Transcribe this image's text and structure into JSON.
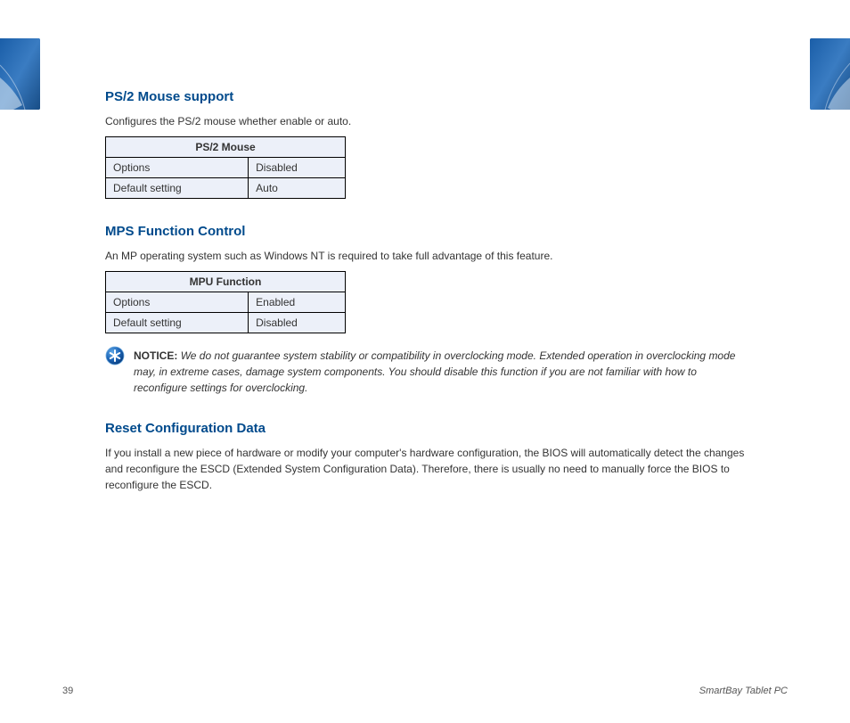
{
  "section1": {
    "title": "PS/2 Mouse support",
    "desc": "Configures the PS/2 mouse whether enable or auto.",
    "table": {
      "header": "PS/2 Mouse",
      "row1": {
        "label": "Options",
        "value": "Disabled"
      },
      "row2": {
        "label": "Default setting",
        "value": "Auto"
      }
    }
  },
  "section2": {
    "title": "MPS Function Control",
    "desc": "An MP operating system such as Windows NT is required to take full advantage of this feature.",
    "table": {
      "header": "MPU Function",
      "row1": {
        "label": "Options",
        "value": "Enabled"
      },
      "row2": {
        "label": "Default setting",
        "value": "Disabled"
      }
    }
  },
  "notice": {
    "label": "NOTICE:",
    "text": "We do not guarantee system stability or compatibility in overclocking mode. Extended operation in overclocking mode may, in extreme cases, damage system components. You should disable this function if you are not familiar with how to reconfigure settings for overclocking."
  },
  "section3": {
    "title": "Reset Configuration Data",
    "desc": "If you install a new piece of hardware or modify your computer's hardware configuration, the BIOS will automatically detect the changes and reconfigure the ESCD (Extended System Configuration Data). Therefore, there is usually no need to manually force the BIOS to reconfigure the ESCD."
  },
  "footer": {
    "page": "39",
    "title": "SmartBay Tablet PC"
  }
}
